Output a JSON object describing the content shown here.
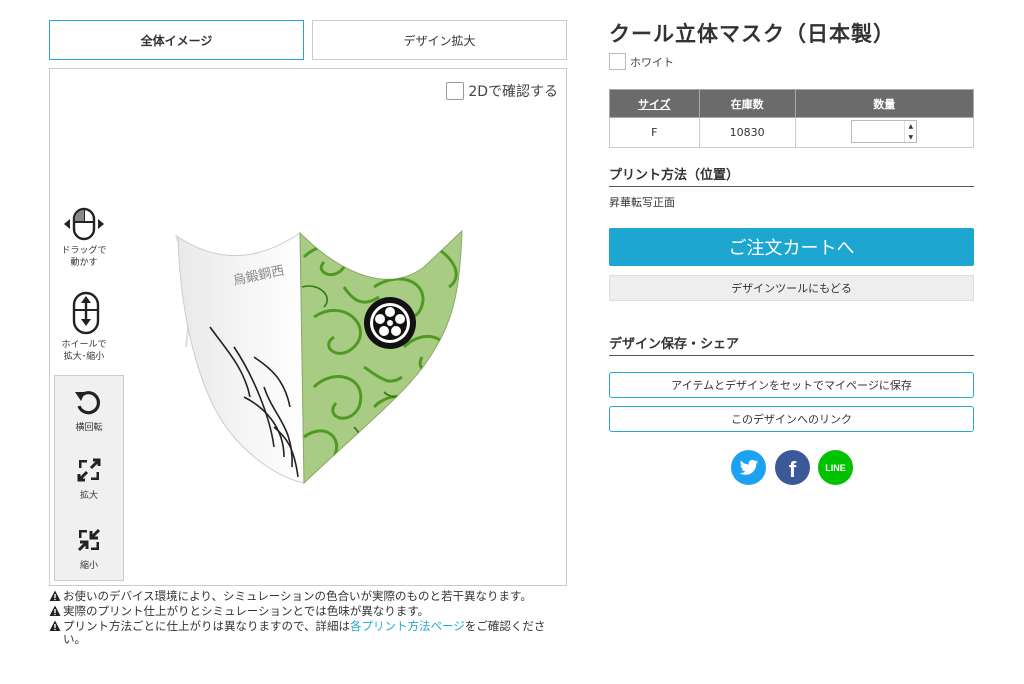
{
  "tabs": [
    {
      "label": "全体イメージ"
    },
    {
      "label": "デザイン拡大"
    }
  ],
  "viewer": {
    "check_2d_label": "2Dで確認する",
    "hints": {
      "drag": "ドラッグで\n動かす",
      "wheel": "ホイールで\n拡大･縮小"
    },
    "controls": [
      {
        "label": "横回転",
        "icon": "rotate-icon"
      },
      {
        "label": "拡大",
        "icon": "expand-icon"
      },
      {
        "label": "縮小",
        "icon": "shrink-icon"
      }
    ],
    "mask_print_text": "烏鍛鋼西"
  },
  "notes": {
    "note1": "お使いのデバイス環境により、シミュレーションの色合いが実際のものと若干異なります。",
    "note2": "実際のプリント仕上がりとシミュレーションとでは色味が異なります。",
    "note3_pre": "プリント方法ごとに仕上がりは異なりますので、詳細は",
    "note3_link": "各プリント方法ページ",
    "note3_post": "をご確認ください。"
  },
  "product": {
    "title": "クール立体マスク（日本製）",
    "color_name": "ホワイト",
    "table": {
      "headers": [
        "サイズ",
        "在庫数",
        "数量"
      ],
      "rows": [
        {
          "size": "F",
          "stock": "10830",
          "qty": ""
        }
      ]
    },
    "print_method_heading": "プリント方法（位置）",
    "print_method_value": "昇華転写正面",
    "cart_button": "ご注文カートへ",
    "back_button": "デザインツールにもどる",
    "share_heading": "デザイン保存・シェア",
    "save_button": "アイテムとデザインをセットでマイページに保存",
    "link_button": "このデザインへのリンク",
    "social": [
      {
        "name": "twitter-icon",
        "color": "#1da1f2"
      },
      {
        "name": "facebook-icon",
        "color": "#3b5998"
      },
      {
        "name": "line-icon",
        "color": "#00c300",
        "label": "LINE"
      }
    ]
  },
  "colors": {
    "accent": "#1da6cf",
    "table_header": "#6b6b6b",
    "mask_green": "#8fbc5a"
  }
}
